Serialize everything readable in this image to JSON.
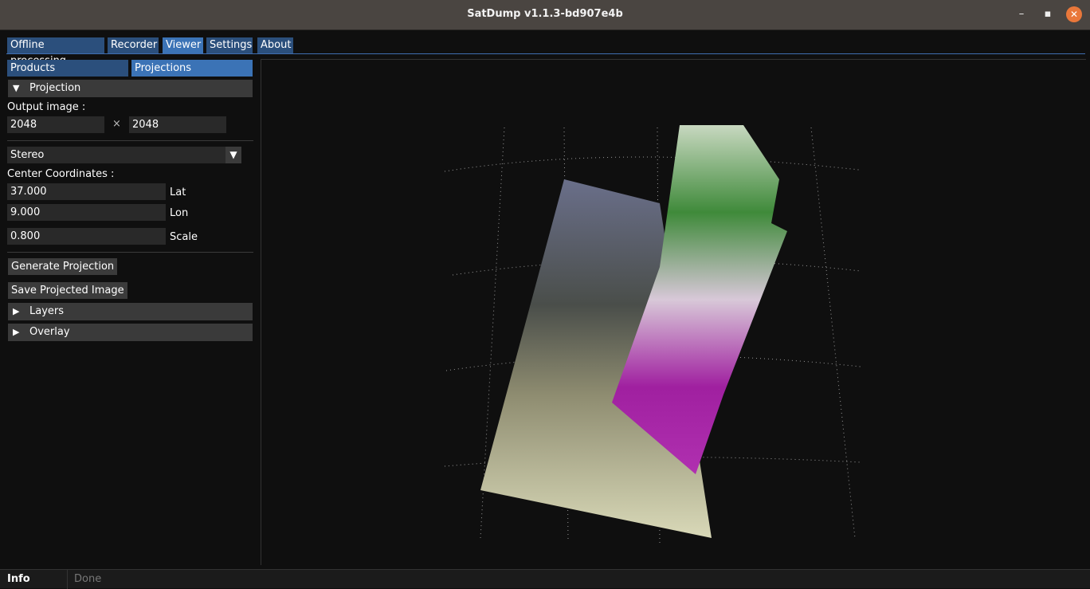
{
  "window": {
    "title": "SatDump v1.1.3-bd907e4b"
  },
  "tabs": [
    {
      "label": "Offline processing"
    },
    {
      "label": "Recorder"
    },
    {
      "label": "Viewer"
    },
    {
      "label": "Settings"
    },
    {
      "label": "About"
    }
  ],
  "sidebar": {
    "subtabs": [
      {
        "label": "Products"
      },
      {
        "label": "Projections"
      }
    ],
    "projection_header": "Projection",
    "output_image_label": "Output image :",
    "output_width": "2048",
    "times_symbol": "×",
    "output_height": "2048",
    "projection_type": "Stereo",
    "center_coords_label": "Center Coordinates :",
    "lat_value": "37.000",
    "lat_label": "Lat",
    "lon_value": "9.000",
    "lon_label": "Lon",
    "scale_value": "0.800",
    "scale_label": "Scale",
    "generate_button": "Generate Projection",
    "save_button": "Save Projected Image",
    "layers_header": "Layers",
    "overlay_header": "Overlay"
  },
  "status": {
    "label": "Info",
    "message": "Done"
  },
  "colors": {
    "tab": "#2b4f7c",
    "tab_active": "#3b73b6",
    "close": "#e9773a"
  }
}
